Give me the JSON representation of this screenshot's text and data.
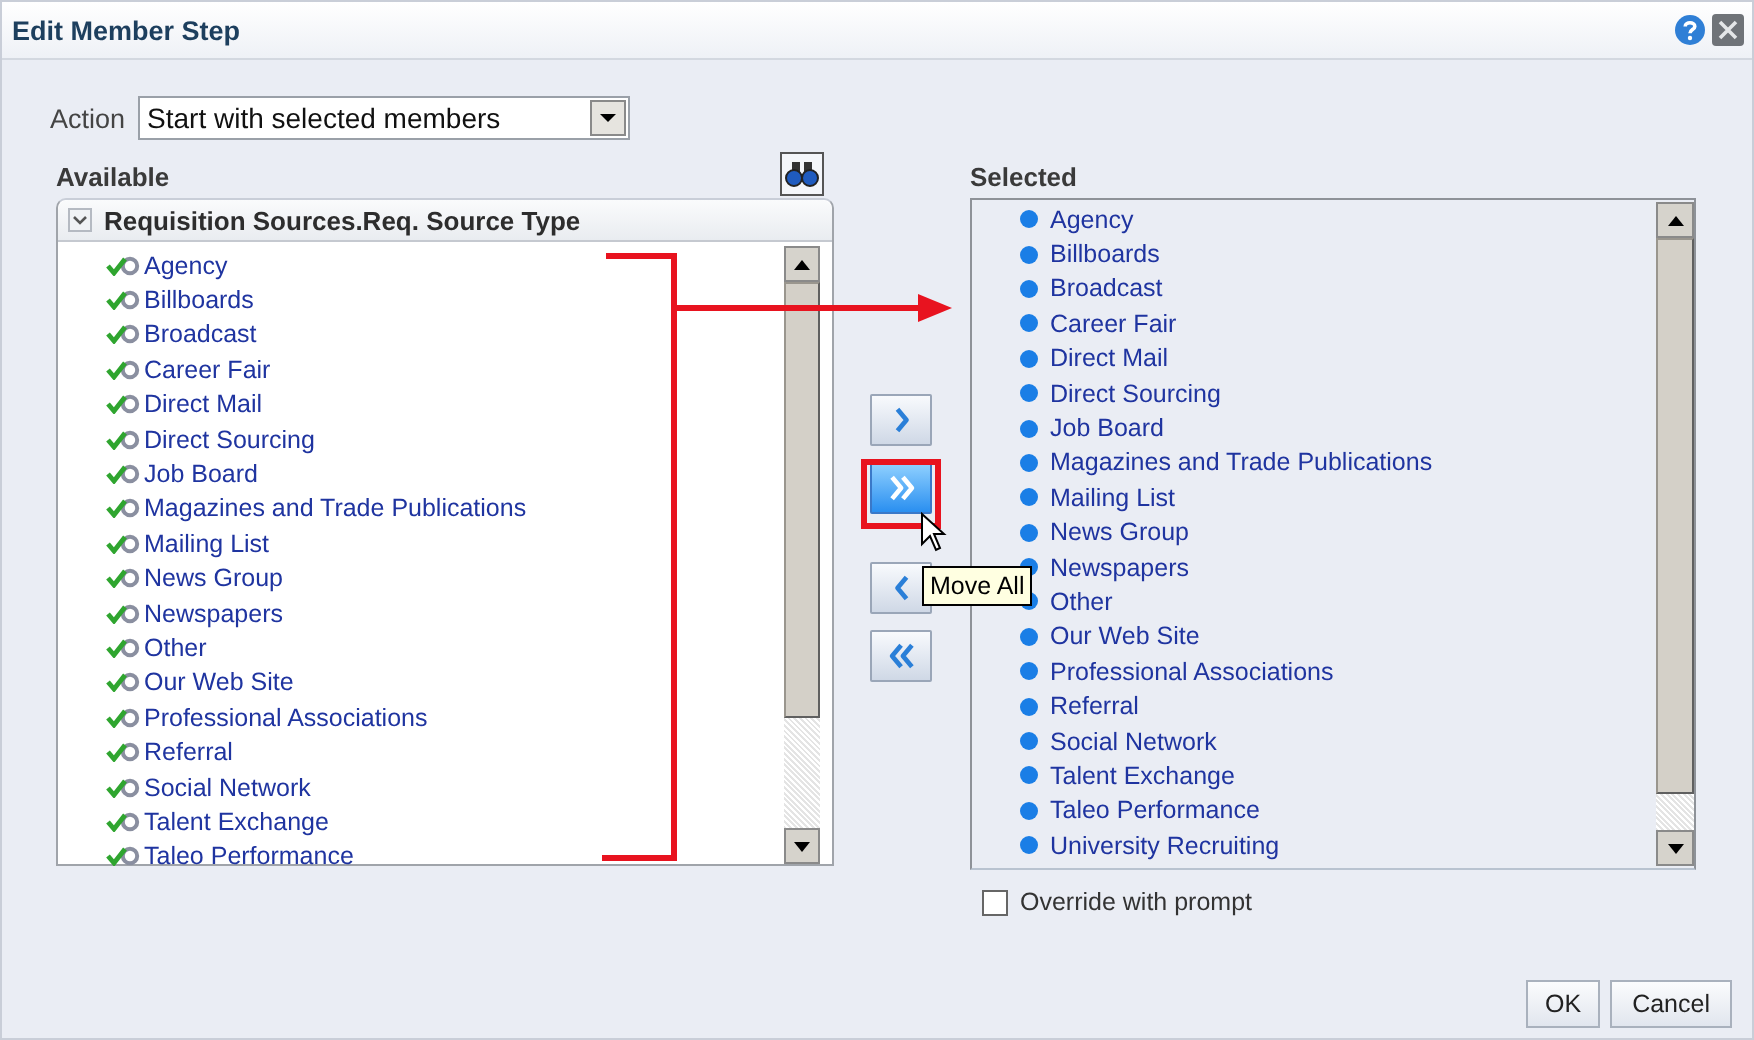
{
  "window": {
    "title": "Edit Member Step"
  },
  "action": {
    "label": "Action",
    "value": "Start with selected members"
  },
  "available": {
    "label": "Available",
    "header": "Requisition Sources.Req. Source Type",
    "expanded": true,
    "items": [
      "Agency",
      "Billboards",
      "Broadcast",
      "Career Fair",
      "Direct Mail",
      "Direct Sourcing",
      "Job Board",
      "Magazines and Trade Publications",
      "Mailing List",
      "News Group",
      "Newspapers",
      "Other",
      "Our Web Site",
      "Professional Associations",
      "Referral",
      "Social Network",
      "Talent Exchange",
      "Taleo Performance"
    ]
  },
  "move_buttons": [
    {
      "kind": "move",
      "highlighted": false
    },
    {
      "kind": "move_all",
      "highlighted": true
    },
    {
      "kind": "remove",
      "highlighted": false
    },
    {
      "kind": "remove_all",
      "highlighted": false
    }
  ],
  "tooltip": "Move All",
  "selected": {
    "label": "Selected",
    "items": [
      "Agency",
      "Billboards",
      "Broadcast",
      "Career Fair",
      "Direct Mail",
      "Direct Sourcing",
      "Job Board",
      "Magazines and Trade Publications",
      "Mailing List",
      "News Group",
      "Newspapers",
      "Other",
      "Our Web Site",
      "Professional Associations",
      "Referral",
      "Social Network",
      "Talent Exchange",
      "Taleo Performance",
      "University Recruiting"
    ]
  },
  "override": {
    "label": "Override with prompt",
    "checked": false
  },
  "buttons": [
    "OK",
    "Cancel"
  ]
}
